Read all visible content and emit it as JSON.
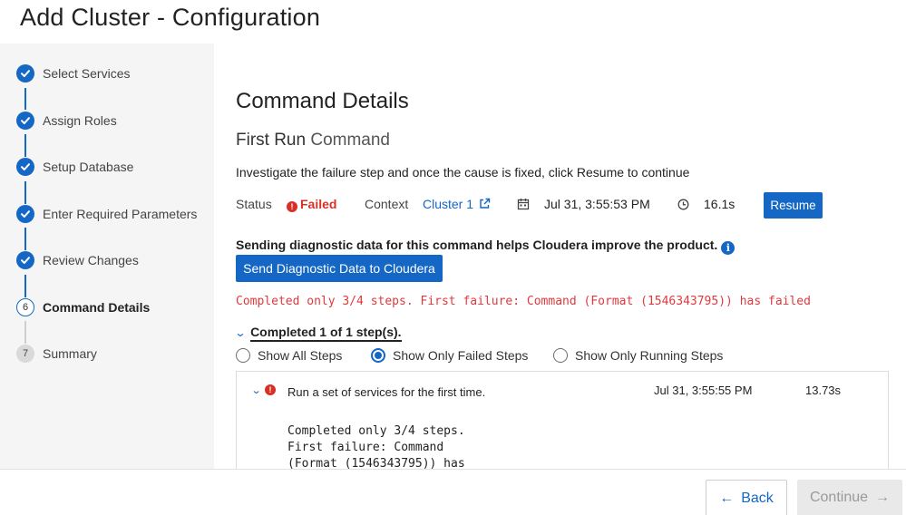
{
  "header": {
    "title": "Add Cluster - Configuration"
  },
  "wizard": {
    "steps": [
      {
        "label": "Select Services",
        "state": "done"
      },
      {
        "label": "Assign Roles",
        "state": "done"
      },
      {
        "label": "Setup Database",
        "state": "done"
      },
      {
        "label": "Enter Required Parameters",
        "state": "done"
      },
      {
        "label": "Review Changes",
        "state": "done"
      },
      {
        "label": "Command Details",
        "state": "current",
        "number": "6"
      },
      {
        "label": "Summary",
        "state": "future",
        "number": "7"
      }
    ]
  },
  "command": {
    "title": "Command Details",
    "subtitle_main": "First Run",
    "subtitle_muted": "Command",
    "instructions": "Investigate the failure step and once the cause is fixed, click Resume to continue",
    "status_label": "Status",
    "status_value": "Failed",
    "context_label": "Context",
    "context_value": "Cluster 1",
    "timestamp": "Jul 31, 3:55:53 PM",
    "duration": "16.1s",
    "resume_label": "Resume",
    "diagnostic_text": "Sending diagnostic data for this command helps Cloudera improve the product.",
    "diagnostic_button": "Send Diagnostic Data to Cloudera",
    "error_message": "Completed only 3/4 steps. First failure: Command (Format (1546343795)) has failed",
    "completed_summary": "Completed 1 of 1 step(s).",
    "filters": [
      {
        "label": "Show All Steps",
        "checked": false
      },
      {
        "label": "Show Only Failed Steps",
        "checked": true
      },
      {
        "label": "Show Only Running Steps",
        "checked": false
      }
    ],
    "step_rows": [
      {
        "description": "Run a set of services for the first time.",
        "detail_line1": "Completed only 3/4 steps.",
        "detail_line2": "First failure: Command",
        "detail_line3": "(Format (1546343795)) has",
        "timestamp": "Jul 31, 3:55:55 PM",
        "duration": "13.73s"
      }
    ]
  },
  "footer": {
    "back_label": "Back",
    "continue_label": "Continue"
  },
  "colors": {
    "accent": "#1467c4",
    "error": "#d93025",
    "sidebar_bg": "#f5f5f5"
  }
}
